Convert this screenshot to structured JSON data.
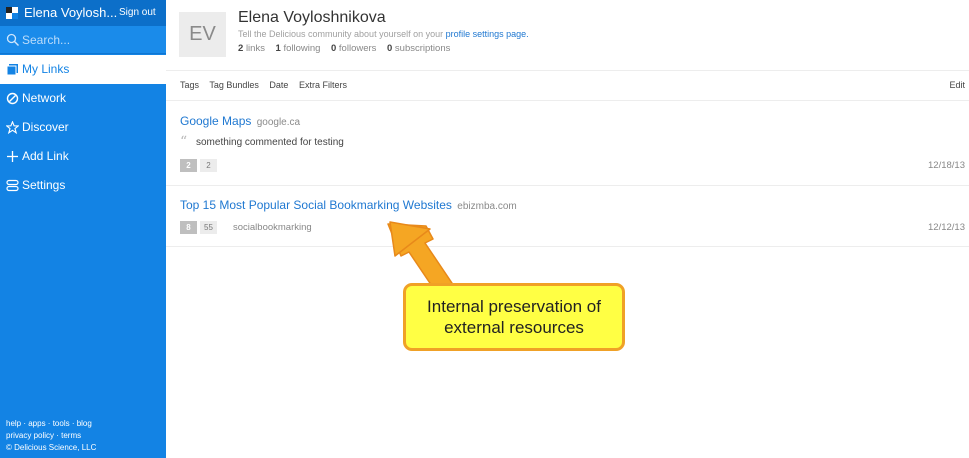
{
  "sidebar": {
    "user_name": "Elena Voylosh...",
    "sign_out": "Sign out",
    "search_placeholder": "Search...",
    "nav": [
      {
        "label": "My Links",
        "icon": "my-links-icon"
      },
      {
        "label": "Network",
        "icon": "network-icon"
      },
      {
        "label": "Discover",
        "icon": "star-icon"
      },
      {
        "label": "Add Link",
        "icon": "plus-icon"
      },
      {
        "label": "Settings",
        "icon": "settings-icon"
      }
    ],
    "footer": {
      "line1": "help · apps · tools · blog",
      "line2": "privacy policy · terms",
      "line3": "© Delicious Science, LLC"
    }
  },
  "profile": {
    "initials": "EV",
    "name": "Elena Voyloshnikova",
    "tagline_prefix": "Tell the Delicious community about yourself on your ",
    "tagline_link": "profile settings page.",
    "stats": {
      "links_count": "2",
      "links_label": "links",
      "following_count": "1",
      "following_label": "following",
      "followers_count": "0",
      "followers_label": "followers",
      "subscriptions_count": "0",
      "subscriptions_label": "subscriptions"
    }
  },
  "filters": {
    "items": [
      "Tags",
      "Tag Bundles",
      "Date",
      "Extra Filters"
    ],
    "edit": "Edit"
  },
  "links": [
    {
      "title": "Google Maps",
      "domain": "google.ca",
      "comment": "something commented for testing",
      "count_a": "2",
      "count_b": "2",
      "tag": "",
      "date": "12/18/13"
    },
    {
      "title": "Top 15 Most Popular Social Bookmarking Websites",
      "domain": "ebizmba.com",
      "comment": "",
      "count_a": "8",
      "count_b": "55",
      "tag": "socialbookmarking",
      "date": "12/12/13"
    }
  ],
  "annotation": {
    "line1": "Internal preservation of",
    "line2": "external resources",
    "fill_color": "#ffff44",
    "border_color": "#f0a126",
    "arrow_color": "#f5a623"
  },
  "colors": {
    "sidebar": "#1383e4",
    "link": "#1f78d1"
  }
}
